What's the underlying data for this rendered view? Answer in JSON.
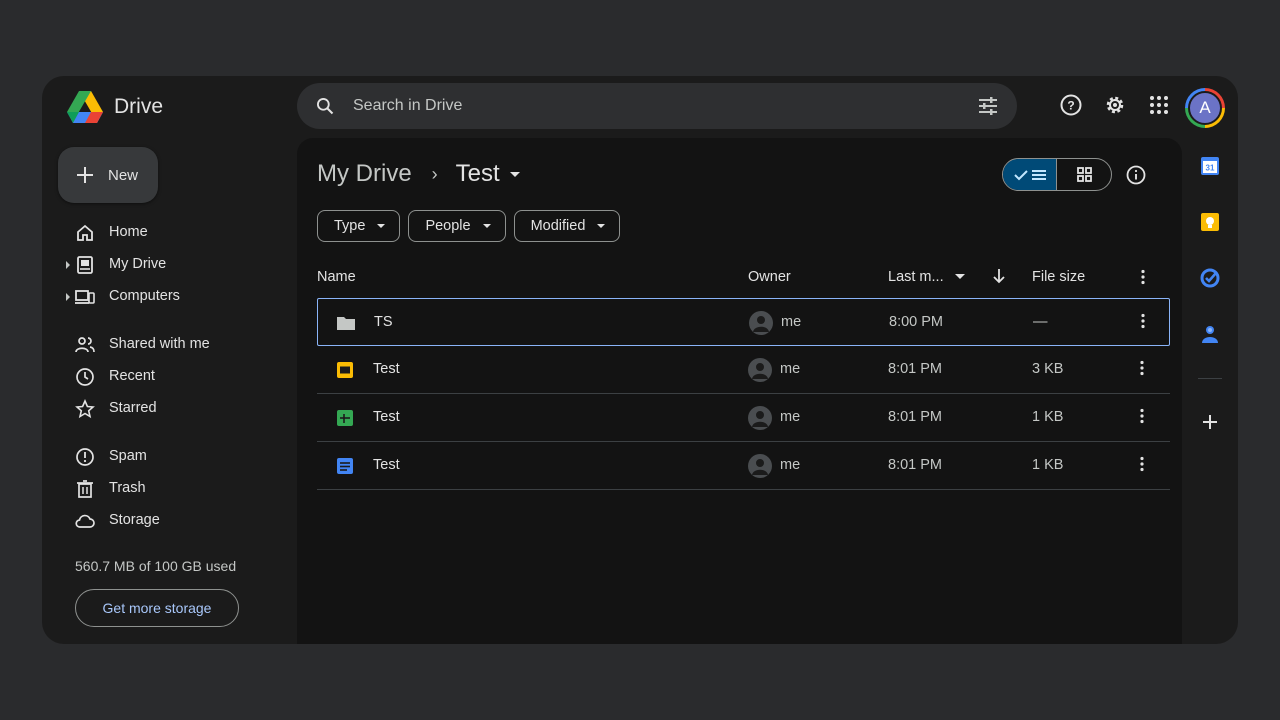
{
  "app": {
    "name": "Drive"
  },
  "search": {
    "placeholder": "Search in Drive"
  },
  "user": {
    "initial": "A"
  },
  "sidebar": {
    "new_label": "New",
    "items": [
      {
        "label": "Home",
        "icon": "home-icon"
      },
      {
        "label": "My Drive",
        "icon": "my-drive-icon",
        "expandable": true
      },
      {
        "label": "Computers",
        "icon": "computers-icon",
        "expandable": true
      },
      {
        "label": "Shared with me",
        "icon": "shared-icon"
      },
      {
        "label": "Recent",
        "icon": "clock-icon"
      },
      {
        "label": "Starred",
        "icon": "star-icon"
      },
      {
        "label": "Spam",
        "icon": "spam-icon"
      },
      {
        "label": "Trash",
        "icon": "trash-icon"
      },
      {
        "label": "Storage",
        "icon": "cloud-icon"
      }
    ],
    "storage_used": "560.7 MB of 100 GB used",
    "storage_button": "Get more storage"
  },
  "breadcrumb": {
    "parent": "My Drive",
    "current": "Test"
  },
  "filters": [
    "Type",
    "People",
    "Modified"
  ],
  "table": {
    "columns": {
      "name": "Name",
      "owner": "Owner",
      "modified": "Last m...",
      "size": "File size"
    },
    "rows": [
      {
        "name": "TS",
        "type": "folder",
        "owner": "me",
        "modified": "8:00 PM",
        "size": "—",
        "selected": true
      },
      {
        "name": "Test",
        "type": "slides",
        "owner": "me",
        "modified": "8:01 PM",
        "size": "3 KB"
      },
      {
        "name": "Test",
        "type": "sheets",
        "owner": "me",
        "modified": "8:01 PM",
        "size": "1 KB"
      },
      {
        "name": "Test",
        "type": "docs",
        "owner": "me",
        "modified": "8:01 PM",
        "size": "1 KB"
      }
    ]
  },
  "colors": {
    "accent": "#a8c7fa",
    "slides": "#fbbc04",
    "sheets": "#34a853",
    "docs": "#4285f4"
  }
}
